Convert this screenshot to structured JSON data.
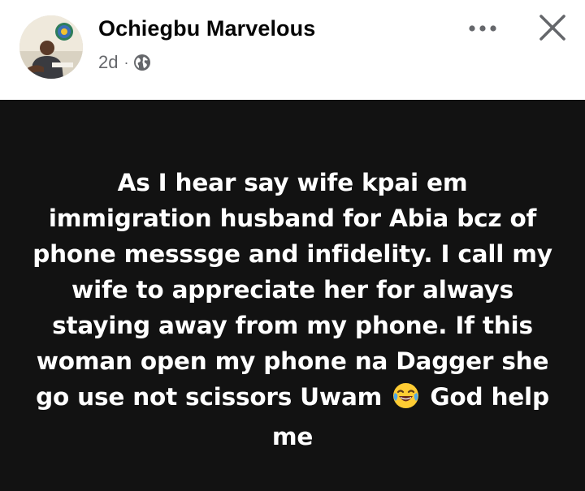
{
  "post": {
    "author_name": "Ochiegbu Marvelous",
    "time_ago": "2d",
    "separator": "·",
    "privacy_icon": "globe-icon",
    "more_icon": "more-dots-icon",
    "close_icon": "close-icon",
    "body_before_emoji": "As I hear say wife kpai em immigration husband for Abia bcz of phone messsge and infidelity. I call my wife to appreciate her for always staying away from my phone.   If this woman open my phone na Dagger she go use not scissors Uwam",
    "emoji": "face-with-tears-of-joy",
    "body_after_emoji": "God help me",
    "background_color": "#121212",
    "text_color": "#ffffff"
  }
}
